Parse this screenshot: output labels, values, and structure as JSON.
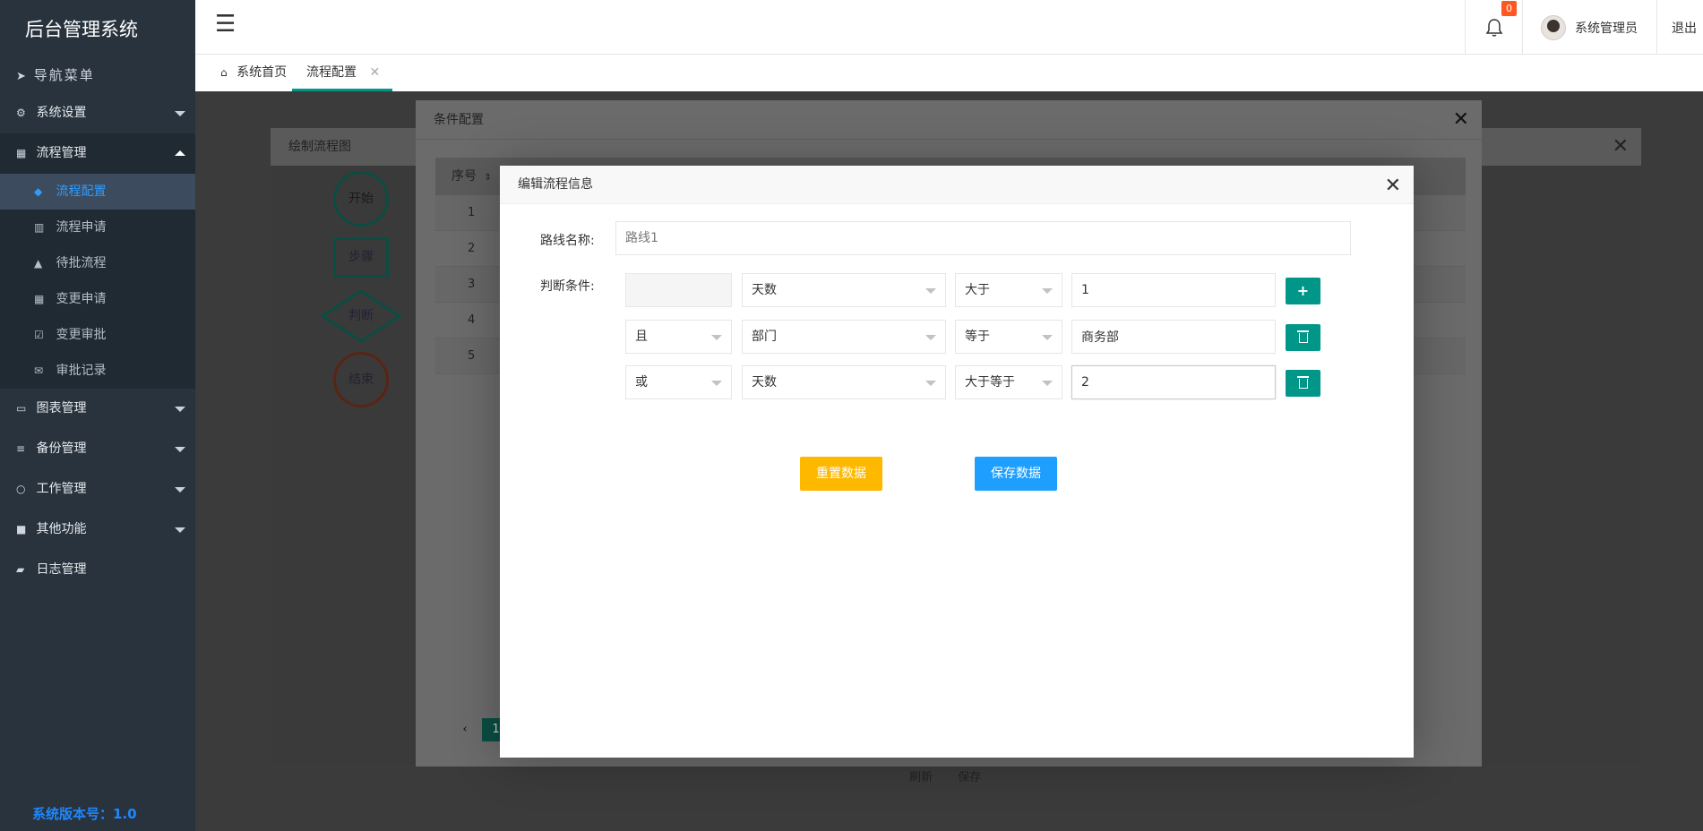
{
  "sidebar": {
    "brand": "后台管理系统",
    "nav_head": "导航菜单",
    "items": [
      {
        "label": "系统设置",
        "icon": "gear-icon"
      },
      {
        "label": "流程管理",
        "icon": "table-icon"
      },
      {
        "label": "图表管理",
        "icon": "monitor-icon"
      },
      {
        "label": "备份管理",
        "icon": "database-icon"
      },
      {
        "label": "工作管理",
        "icon": "circle-icon"
      },
      {
        "label": "其他功能",
        "icon": "briefcase-icon"
      },
      {
        "label": "日志管理",
        "icon": "book-icon"
      }
    ],
    "submenu": [
      {
        "label": "流程配置",
        "icon": "dropbox-icon"
      },
      {
        "label": "流程申请",
        "icon": "bar-chart-icon"
      },
      {
        "label": "待批流程",
        "icon": "warning-icon"
      },
      {
        "label": "变更申请",
        "icon": "grid-icon"
      },
      {
        "label": "变更审批",
        "icon": "check-square-icon"
      },
      {
        "label": "审批记录",
        "icon": "envelope-icon"
      }
    ],
    "version": "系统版本号：1.0"
  },
  "header": {
    "notification_count": "0",
    "user_name": "系统管理员",
    "logout": "退出"
  },
  "tabs": [
    {
      "label": "系统首页"
    },
    {
      "label": "流程配置"
    }
  ],
  "bg_window": {
    "title": "绘制流程图",
    "shapes": [
      "开始",
      "步骤",
      "判断",
      "结束"
    ],
    "bottom_buttons": [
      "刷新",
      "保存"
    ]
  },
  "cond_dialog": {
    "title": "条件配置",
    "column_header": "序号",
    "rows": [
      "1",
      "2",
      "3",
      "4",
      "5"
    ],
    "current_page": "1"
  },
  "edit_dialog": {
    "title": "编辑流程信息",
    "route_label": "路线名称:",
    "route_placeholder": "路线1",
    "condition_label": "判断条件:",
    "conditions": [
      {
        "logic": "",
        "field": "天数",
        "operator": "大于",
        "value": "1"
      },
      {
        "logic": "且",
        "field": "部门",
        "operator": "等于",
        "value": "商务部"
      },
      {
        "logic": "或",
        "field": "天数",
        "operator": "大于等于",
        "value": "2"
      }
    ],
    "reset_button": "重置数据",
    "save_button": "保存数据"
  },
  "colors": {
    "sidebar_bg": "#28333e",
    "active_text": "#2e9dff",
    "teal": "#009688",
    "warning": "#ffb800",
    "primary": "#1e9fff",
    "badge": "#ff5722"
  }
}
